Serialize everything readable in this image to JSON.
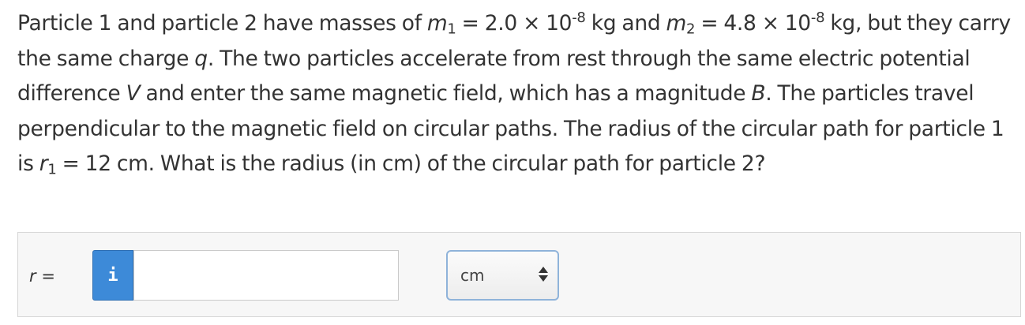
{
  "question": {
    "s1": "Particle 1 and particle 2 have masses of ",
    "m1_sym": "m",
    "m1_sub": "1",
    "m1_val": " = 2.0 × 10",
    "m1_exp": "-8",
    "m1_unit": " kg and ",
    "m2_sym": "m",
    "m2_sub": "2",
    "m2_val": " = 4.8 × 10",
    "m2_exp": "-8",
    "m2_unit": " kg, but they carry the same charge ",
    "q_sym": "q",
    "s2": ". The two particles accelerate from rest through the same electric potential difference ",
    "v_sym": "V",
    "s3": " and enter the same magnetic field, which has a magnitude ",
    "b_sym": "B",
    "s4": ". The particles travel perpendicular to the magnetic field on circular paths. The radius of the circular path for particle 1 is ",
    "r1_sym": "r",
    "r1_sub": "1",
    "r1_val": " = 12 cm. What is the radius (in cm) of the circular path for particle 2?"
  },
  "answer": {
    "label_var": "r",
    "label_eq": " =",
    "info_icon": "i",
    "input_value": "",
    "unit": "cm"
  },
  "icons": {
    "info": "info-icon",
    "select_arrows": "up-down-arrows-icon"
  },
  "colors": {
    "info_button": "#3d8ad8",
    "select_border": "#8fb3da"
  }
}
